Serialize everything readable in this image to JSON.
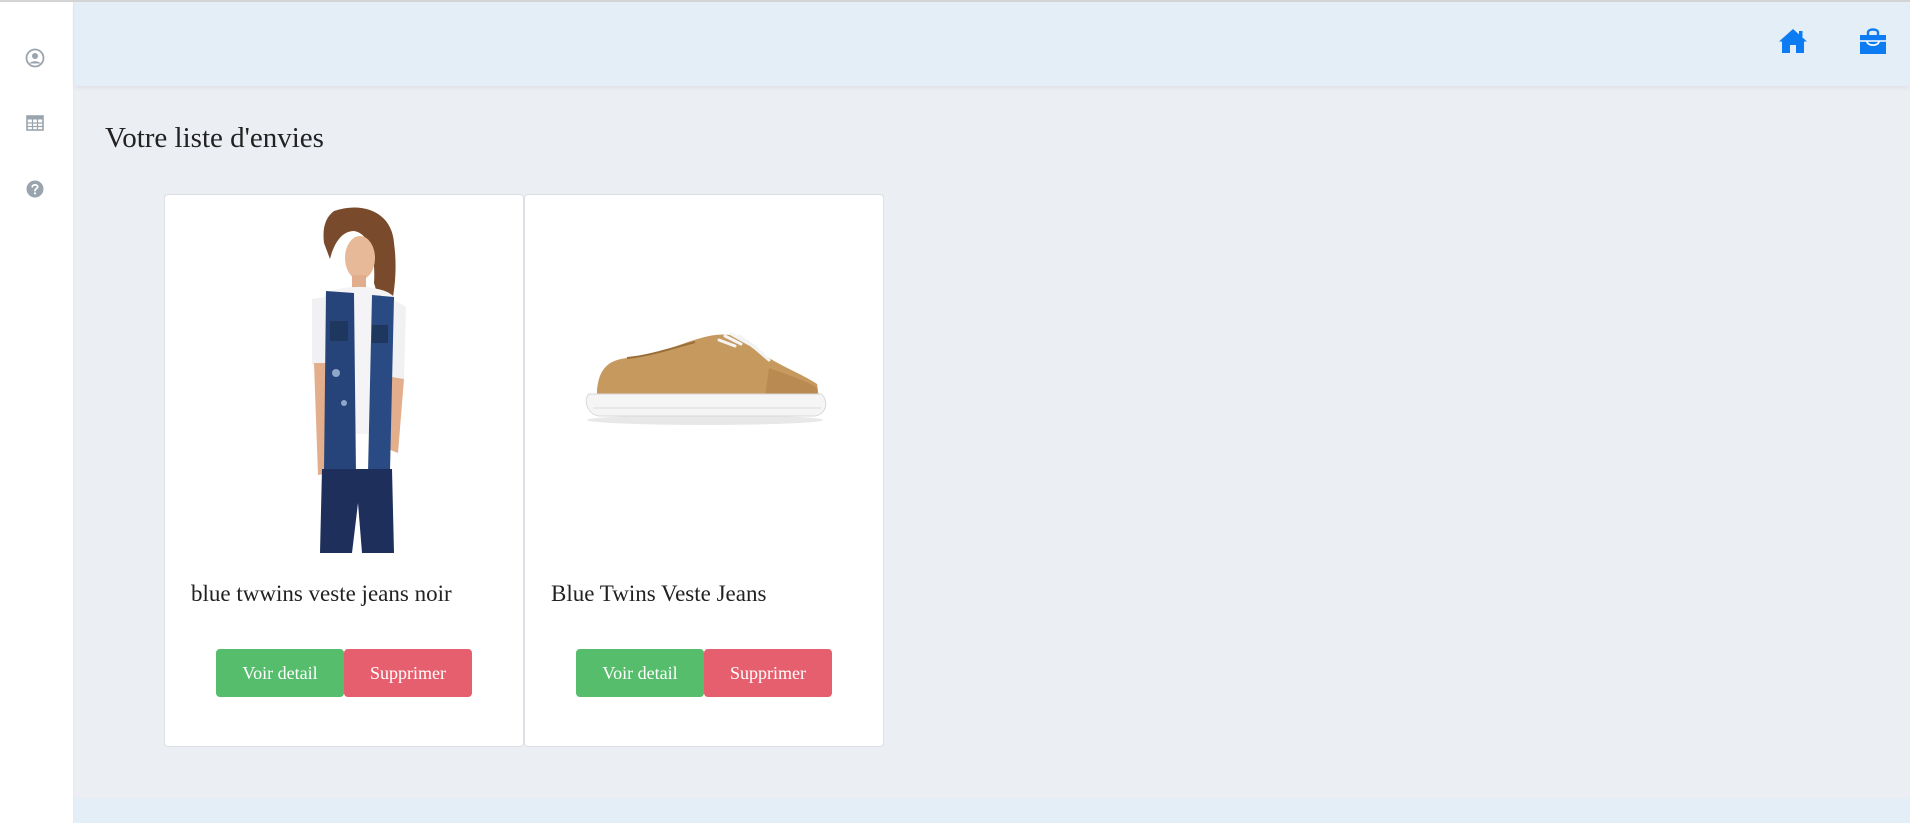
{
  "sidebar": {
    "items": [
      {
        "icon": "user-circle-icon"
      },
      {
        "icon": "table-grid-icon"
      },
      {
        "icon": "question-circle-icon"
      }
    ]
  },
  "header": {
    "icons": [
      "home-icon",
      "shopping-bag-icon"
    ],
    "accent_color": "#0d7cf2"
  },
  "main": {
    "title": "Votre liste d'envies",
    "products": [
      {
        "name": "blue twwins veste jeans noir",
        "image": "woman-denim-vest-photo",
        "detail_label": "Voir detail",
        "delete_label": "Supprimer"
      },
      {
        "name": "Blue Twins Veste Jeans",
        "image": "tan-sneaker-photo",
        "detail_label": "Voir detail",
        "delete_label": "Supprimer"
      }
    ]
  },
  "colors": {
    "detail_button": "#55bd6b",
    "delete_button": "#e65f6e",
    "sidebar_icon": "#9aa4ae"
  }
}
